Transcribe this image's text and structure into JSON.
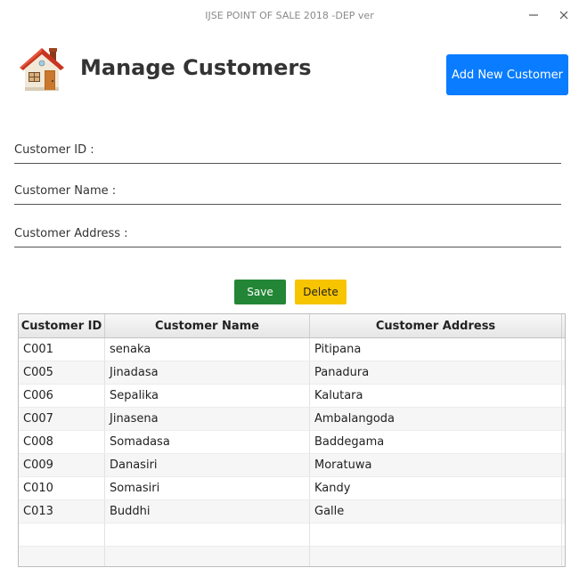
{
  "window": {
    "title": "IJSE POINT OF SALE 2018 -DEP ver"
  },
  "header": {
    "logo_icon": "house-icon",
    "title": "Manage Customers",
    "add_button_label": "Add New Customer"
  },
  "form": {
    "id_label": "Customer ID :",
    "id_value": "",
    "name_label": "Customer Name :",
    "name_value": "",
    "address_label": "Customer Address :",
    "address_value": ""
  },
  "actions": {
    "save_label": "Save",
    "delete_label": "Delete"
  },
  "table": {
    "columns": [
      "Customer ID",
      "Customer Name",
      "Customer Address"
    ],
    "rows": [
      [
        "C001",
        "senaka",
        "Pitipana"
      ],
      [
        "C005",
        "Jinadasa",
        "Panadura"
      ],
      [
        "C006",
        "Sepalika",
        "Kalutara"
      ],
      [
        "C007",
        "Jinasena",
        "Ambalangoda"
      ],
      [
        "C008",
        "Somadasa",
        "Baddegama"
      ],
      [
        "C009",
        "Danasiri",
        "Moratuwa"
      ],
      [
        "C010",
        "Somasiri",
        "Kandy"
      ],
      [
        "C013",
        "Buddhi",
        "Galle"
      ]
    ]
  },
  "colors": {
    "add_button": "#0a7cff",
    "save_button": "#238636",
    "delete_button": "#f7c400"
  }
}
